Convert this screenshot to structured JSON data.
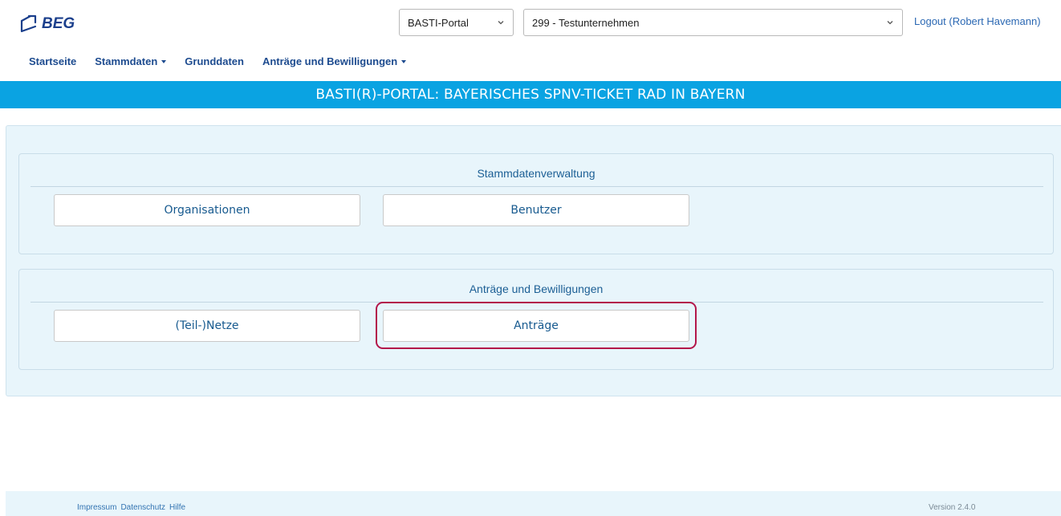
{
  "header": {
    "logo_text": "BEG",
    "portal_select": "BASTI-Portal",
    "company_select": "299 - Testunternehmen",
    "logout": "Logout (Robert Havemann)"
  },
  "nav": {
    "items": [
      {
        "label": "Startseite",
        "dropdown": false
      },
      {
        "label": "Stammdaten",
        "dropdown": true
      },
      {
        "label": "Grunddaten",
        "dropdown": false
      },
      {
        "label": "Anträge und Bewilligungen",
        "dropdown": true
      }
    ]
  },
  "banner": {
    "title": "BASTI(R)-PORTAL: BAYERISCHES SPNV-TICKET RAD IN BAYERN"
  },
  "sections": [
    {
      "title": "Stammdatenverwaltung",
      "buttons": [
        "Organisationen",
        "Benutzer"
      ]
    },
    {
      "title": "Anträge und Bewilligungen",
      "buttons": [
        "(Teil-)Netze",
        "Anträge"
      ]
    }
  ],
  "footer": {
    "links": [
      "Impressum",
      "Datenschutz",
      "Hilfe"
    ],
    "version": "Version 2.4.0"
  },
  "colors": {
    "banner": "#0aa3e2",
    "panel": "#e8f5fb",
    "link": "#2b68b3",
    "highlight": "#b3164a"
  }
}
